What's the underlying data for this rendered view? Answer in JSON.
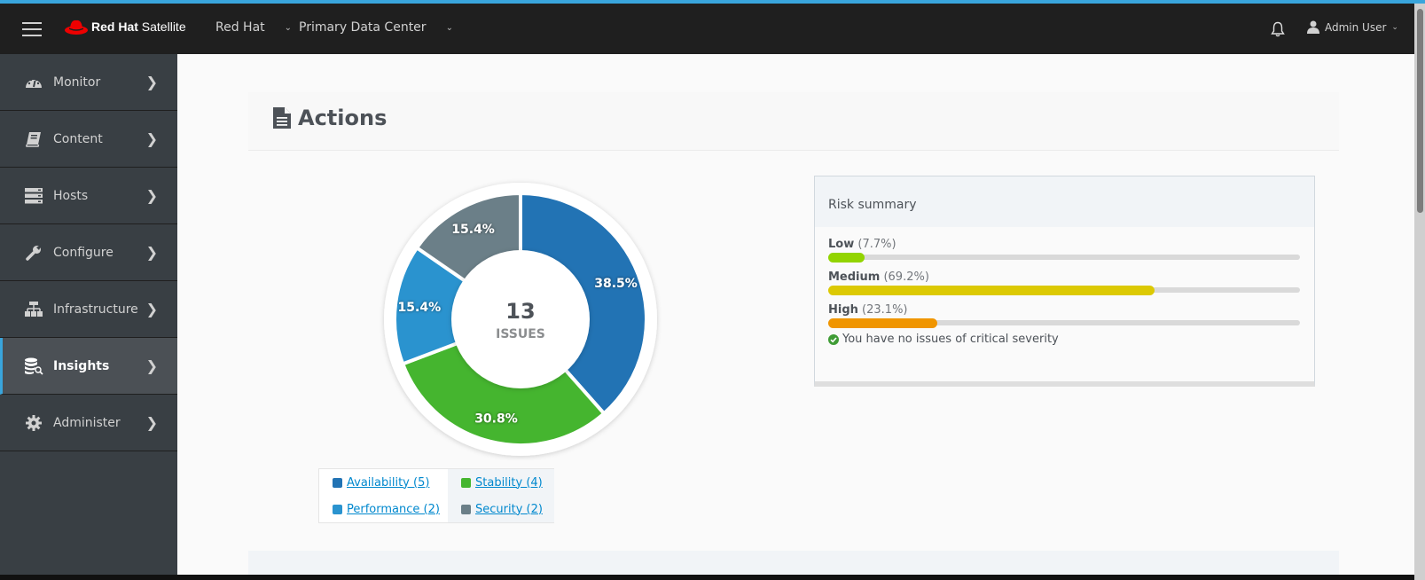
{
  "navbar": {
    "brand_bold": "Red Hat",
    "brand_light": "Satellite",
    "organization": "Red Hat",
    "location": "Primary Data Center",
    "user": "Admin User"
  },
  "sidebar": {
    "items": [
      {
        "label": "Monitor",
        "icon": "dashboard-icon",
        "active": false
      },
      {
        "label": "Content",
        "icon": "book-icon",
        "active": false
      },
      {
        "label": "Hosts",
        "icon": "server-icon",
        "active": false
      },
      {
        "label": "Configure",
        "icon": "wrench-icon",
        "active": false
      },
      {
        "label": "Infrastructure",
        "icon": "network-icon",
        "active": false
      },
      {
        "label": "Insights",
        "icon": "database-search-icon",
        "active": true
      },
      {
        "label": "Administer",
        "icon": "gear-icon",
        "active": false
      }
    ]
  },
  "page": {
    "title": "Actions"
  },
  "chart_data": {
    "type": "pie",
    "title": "",
    "center_value": "13",
    "center_label": "ISSUES",
    "categories": [
      "Availability",
      "Stability",
      "Performance",
      "Security"
    ],
    "values": [
      5,
      4,
      2,
      2
    ],
    "labels": [
      "38.5%",
      "30.8%",
      "15.4%",
      "15.4%"
    ],
    "colors": [
      "#2273b4",
      "#45b52f",
      "#2a93cf",
      "#6b7f88"
    ],
    "legend": [
      {
        "label": "Availability (5)",
        "color": "#2273b4"
      },
      {
        "label": "Stability (4)",
        "color": "#45b52f"
      },
      {
        "label": "Performance (2)",
        "color": "#2a93cf"
      },
      {
        "label": "Security (2)",
        "color": "#6b7f88"
      }
    ],
    "legend_position": "bottom"
  },
  "risk_summary": {
    "title": "Risk summary",
    "levels": [
      {
        "name": "Low",
        "pct_label": "(7.7%)",
        "fraction": 0.077,
        "color": "#92d400"
      },
      {
        "name": "Medium",
        "pct_label": "(69.2%)",
        "fraction": 0.692,
        "color": "#dcc903"
      },
      {
        "name": "High",
        "pct_label": "(23.1%)",
        "fraction": 0.231,
        "color": "#f09500"
      }
    ],
    "note": "You have no issues of critical severity",
    "note_color": "#3f9c35"
  }
}
